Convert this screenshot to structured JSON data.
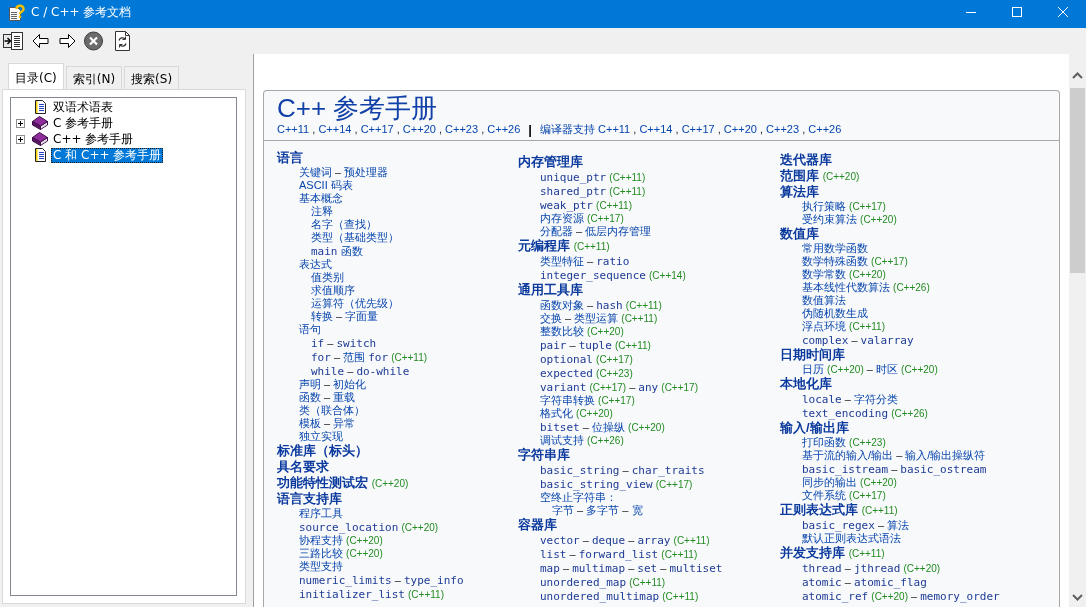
{
  "window": {
    "title": "C / C++ 参考文档"
  },
  "tabs": [
    {
      "label": "目录(C)",
      "selected": true
    },
    {
      "label": "索引(N)",
      "selected": false
    },
    {
      "label": "搜索(S)",
      "selected": false
    }
  ],
  "tree": {
    "items": [
      {
        "kind": "page",
        "label": "双语术语表",
        "selected": false
      },
      {
        "kind": "book",
        "label": "C 参考手册",
        "expanded": false,
        "selected": false
      },
      {
        "kind": "book",
        "label": "C++ 参考手册",
        "expanded": false,
        "selected": false
      },
      {
        "kind": "page",
        "label": "C 和 C++ 参考手册",
        "selected": true
      }
    ]
  },
  "page": {
    "title": "C++ 参考手册",
    "standards": [
      {
        "kind": "link",
        "text": "C++11"
      },
      {
        "kind": "sep",
        "text": ","
      },
      {
        "kind": "link",
        "text": "C++14"
      },
      {
        "kind": "sep",
        "text": ","
      },
      {
        "kind": "link",
        "text": "C++17"
      },
      {
        "kind": "sep",
        "text": ","
      },
      {
        "kind": "link",
        "text": "C++20"
      },
      {
        "kind": "sep",
        "text": ","
      },
      {
        "kind": "link",
        "text": "C++23"
      },
      {
        "kind": "sep",
        "text": ","
      },
      {
        "kind": "link",
        "text": "C++26"
      }
    ],
    "divider": "|",
    "compiler_support": [
      {
        "kind": "link",
        "text": "编译器支持"
      },
      {
        "kind": "link",
        "text": "C++11"
      },
      {
        "kind": "sep",
        "text": ","
      },
      {
        "kind": "link",
        "text": "C++14"
      },
      {
        "kind": "sep",
        "text": ","
      },
      {
        "kind": "link",
        "text": "C++17"
      },
      {
        "kind": "sep",
        "text": ","
      },
      {
        "kind": "link",
        "text": "C++20"
      },
      {
        "kind": "sep",
        "text": ","
      },
      {
        "kind": "link",
        "text": "C++23"
      },
      {
        "kind": "sep",
        "text": ","
      },
      {
        "kind": "link",
        "text": "C++26"
      }
    ],
    "columns": [
      {
        "sections": [
          {
            "heading": [
              {
                "kind": "text",
                "text": "语言"
              }
            ],
            "items": [
              {
                "parts": [
                  {
                    "kind": "text",
                    "text": "关键词"
                  },
                  {
                    "kind": "sep",
                    "text": "–"
                  },
                  {
                    "kind": "text",
                    "text": "预处理器"
                  }
                ]
              },
              {
                "parts": [
                  {
                    "kind": "text",
                    "text": "ASCII 码表"
                  }
                ]
              },
              {
                "parts": [
                  {
                    "kind": "text",
                    "text": "基本概念"
                  }
                ],
                "children": [
                  {
                    "parts": [
                      {
                        "kind": "text",
                        "text": "注释"
                      }
                    ]
                  },
                  {
                    "parts": [
                      {
                        "kind": "text",
                        "text": "名字（查找）"
                      }
                    ]
                  },
                  {
                    "parts": [
                      {
                        "kind": "text",
                        "text": "类型（基础类型）"
                      }
                    ]
                  },
                  {
                    "parts": [
                      {
                        "kind": "code",
                        "text": "main"
                      },
                      {
                        "kind": "text",
                        "text": "函数"
                      }
                    ]
                  }
                ]
              },
              {
                "parts": [
                  {
                    "kind": "text",
                    "text": "表达式"
                  }
                ],
                "children": [
                  {
                    "parts": [
                      {
                        "kind": "text",
                        "text": "值类别"
                      }
                    ]
                  },
                  {
                    "parts": [
                      {
                        "kind": "text",
                        "text": "求值顺序"
                      }
                    ]
                  },
                  {
                    "parts": [
                      {
                        "kind": "text",
                        "text": "运算符（优先级）"
                      }
                    ]
                  },
                  {
                    "parts": [
                      {
                        "kind": "text",
                        "text": "转换"
                      },
                      {
                        "kind": "sep",
                        "text": "–"
                      },
                      {
                        "kind": "text",
                        "text": "字面量"
                      }
                    ]
                  }
                ]
              },
              {
                "parts": [
                  {
                    "kind": "text",
                    "text": "语句"
                  }
                ],
                "children": [
                  {
                    "parts": [
                      {
                        "kind": "code",
                        "text": "if"
                      },
                      {
                        "kind": "sep",
                        "text": "–"
                      },
                      {
                        "kind": "code",
                        "text": "switch"
                      }
                    ]
                  },
                  {
                    "parts": [
                      {
                        "kind": "code",
                        "text": "for"
                      },
                      {
                        "kind": "sep",
                        "text": "–"
                      },
                      {
                        "kind": "text",
                        "text": "范围"
                      },
                      {
                        "kind": "code",
                        "text": "for"
                      },
                      {
                        "kind": "version",
                        "text": "(C++11)"
                      }
                    ]
                  },
                  {
                    "parts": [
                      {
                        "kind": "code",
                        "text": "while"
                      },
                      {
                        "kind": "sep",
                        "text": "–"
                      },
                      {
                        "kind": "code",
                        "text": "do-while"
                      }
                    ]
                  }
                ]
              },
              {
                "parts": [
                  {
                    "kind": "text",
                    "text": "声明"
                  },
                  {
                    "kind": "sep",
                    "text": "–"
                  },
                  {
                    "kind": "text",
                    "text": "初始化"
                  }
                ]
              },
              {
                "parts": [
                  {
                    "kind": "text",
                    "text": "函数"
                  },
                  {
                    "kind": "sep",
                    "text": "–"
                  },
                  {
                    "kind": "text",
                    "text": "重载"
                  }
                ]
              },
              {
                "parts": [
                  {
                    "kind": "text",
                    "text": "类（联合体）"
                  }
                ]
              },
              {
                "parts": [
                  {
                    "kind": "text",
                    "text": "模板"
                  },
                  {
                    "kind": "sep",
                    "text": "–"
                  },
                  {
                    "kind": "text",
                    "text": "异常"
                  }
                ]
              },
              {
                "parts": [
                  {
                    "kind": "text",
                    "text": "独立实现"
                  }
                ]
              }
            ]
          },
          {
            "heading": [
              {
                "kind": "text",
                "text": "标准库（标头）"
              }
            ]
          },
          {
            "heading": [
              {
                "kind": "text",
                "text": "具名要求"
              }
            ]
          },
          {
            "heading": [
              {
                "kind": "text",
                "text": "功能特性测试宏"
              },
              {
                "kind": "version",
                "text": "(C++20)"
              }
            ]
          },
          {
            "heading": [
              {
                "kind": "text",
                "text": "语言支持库"
              }
            ],
            "items": [
              {
                "parts": [
                  {
                    "kind": "text",
                    "text": "程序工具"
                  }
                ]
              },
              {
                "parts": [
                  {
                    "kind": "code",
                    "text": "source_location"
                  },
                  {
                    "kind": "version",
                    "text": "(C++20)"
                  }
                ]
              },
              {
                "parts": [
                  {
                    "kind": "text",
                    "text": "协程支持"
                  },
                  {
                    "kind": "version",
                    "text": "(C++20)"
                  }
                ]
              },
              {
                "parts": [
                  {
                    "kind": "text",
                    "text": "三路比较"
                  },
                  {
                    "kind": "version",
                    "text": "(C++20)"
                  }
                ]
              },
              {
                "parts": [
                  {
                    "kind": "text",
                    "text": "类型支持"
                  }
                ]
              },
              {
                "parts": [
                  {
                    "kind": "code",
                    "text": "numeric_limits"
                  },
                  {
                    "kind": "sep",
                    "text": "–"
                  },
                  {
                    "kind": "code",
                    "text": "type_info"
                  }
                ]
              },
              {
                "parts": [
                  {
                    "kind": "code",
                    "text": "initializer_list"
                  },
                  {
                    "kind": "version",
                    "text": "(C++11)"
                  }
                ]
              }
            ]
          }
        ]
      },
      {
        "sections": [
          {
            "heading": [
              {
                "kind": "text",
                "text": "内存管理库"
              }
            ],
            "items": [
              {
                "parts": [
                  {
                    "kind": "code",
                    "text": "unique_ptr"
                  },
                  {
                    "kind": "version",
                    "text": "(C++11)"
                  }
                ]
              },
              {
                "parts": [
                  {
                    "kind": "code",
                    "text": "shared_ptr"
                  },
                  {
                    "kind": "version",
                    "text": "(C++11)"
                  }
                ]
              },
              {
                "parts": [
                  {
                    "kind": "code",
                    "text": "weak_ptr"
                  },
                  {
                    "kind": "version",
                    "text": "(C++11)"
                  }
                ]
              },
              {
                "parts": [
                  {
                    "kind": "text",
                    "text": "内存资源"
                  },
                  {
                    "kind": "version",
                    "text": "(C++17)"
                  }
                ]
              },
              {
                "parts": [
                  {
                    "kind": "text",
                    "text": "分配器"
                  },
                  {
                    "kind": "sep",
                    "text": "–"
                  },
                  {
                    "kind": "text",
                    "text": "低层内存管理"
                  }
                ]
              }
            ]
          },
          {
            "heading": [
              {
                "kind": "text",
                "text": "元编程库"
              },
              {
                "kind": "version",
                "text": "(C++11)"
              }
            ],
            "items": [
              {
                "parts": [
                  {
                    "kind": "text",
                    "text": "类型特征"
                  },
                  {
                    "kind": "sep",
                    "text": "–"
                  },
                  {
                    "kind": "code",
                    "text": "ratio"
                  }
                ]
              },
              {
                "parts": [
                  {
                    "kind": "code",
                    "text": "integer_sequence"
                  },
                  {
                    "kind": "version",
                    "text": "(C++14)"
                  }
                ]
              }
            ]
          },
          {
            "heading": [
              {
                "kind": "text",
                "text": "通用工具库"
              }
            ],
            "items": [
              {
                "parts": [
                  {
                    "kind": "text",
                    "text": "函数对象"
                  },
                  {
                    "kind": "sep",
                    "text": "–"
                  },
                  {
                    "kind": "code",
                    "text": "hash"
                  },
                  {
                    "kind": "version",
                    "text": "(C++11)"
                  }
                ]
              },
              {
                "parts": [
                  {
                    "kind": "text",
                    "text": "交换"
                  },
                  {
                    "kind": "sep",
                    "text": "–"
                  },
                  {
                    "kind": "text",
                    "text": "类型运算"
                  },
                  {
                    "kind": "version",
                    "text": "(C++11)"
                  }
                ]
              },
              {
                "parts": [
                  {
                    "kind": "text",
                    "text": "整数比较"
                  },
                  {
                    "kind": "version",
                    "text": "(C++20)"
                  }
                ]
              },
              {
                "parts": [
                  {
                    "kind": "code",
                    "text": "pair"
                  },
                  {
                    "kind": "sep",
                    "text": "–"
                  },
                  {
                    "kind": "code",
                    "text": "tuple"
                  },
                  {
                    "kind": "version",
                    "text": "(C++11)"
                  }
                ]
              },
              {
                "parts": [
                  {
                    "kind": "code",
                    "text": "optional"
                  },
                  {
                    "kind": "version",
                    "text": "(C++17)"
                  }
                ]
              },
              {
                "parts": [
                  {
                    "kind": "code",
                    "text": "expected"
                  },
                  {
                    "kind": "version",
                    "text": "(C++23)"
                  }
                ]
              },
              {
                "parts": [
                  {
                    "kind": "code",
                    "text": "variant"
                  },
                  {
                    "kind": "version",
                    "text": "(C++17)"
                  },
                  {
                    "kind": "sep",
                    "text": "–"
                  },
                  {
                    "kind": "code",
                    "text": "any"
                  },
                  {
                    "kind": "version",
                    "text": "(C++17)"
                  }
                ]
              },
              {
                "parts": [
                  {
                    "kind": "text",
                    "text": "字符串转换"
                  },
                  {
                    "kind": "version",
                    "text": "(C++17)"
                  }
                ]
              },
              {
                "parts": [
                  {
                    "kind": "text",
                    "text": "格式化"
                  },
                  {
                    "kind": "version",
                    "text": "(C++20)"
                  }
                ]
              },
              {
                "parts": [
                  {
                    "kind": "code",
                    "text": "bitset"
                  },
                  {
                    "kind": "sep",
                    "text": "–"
                  },
                  {
                    "kind": "text",
                    "text": "位操纵"
                  },
                  {
                    "kind": "version",
                    "text": "(C++20)"
                  }
                ]
              },
              {
                "parts": [
                  {
                    "kind": "text",
                    "text": "调试支持"
                  },
                  {
                    "kind": "version",
                    "text": "(C++26)"
                  }
                ]
              }
            ]
          },
          {
            "heading": [
              {
                "kind": "text",
                "text": "字符串库"
              }
            ],
            "items": [
              {
                "parts": [
                  {
                    "kind": "code",
                    "text": "basic_string"
                  },
                  {
                    "kind": "sep",
                    "text": "–"
                  },
                  {
                    "kind": "code",
                    "text": "char_traits"
                  }
                ]
              },
              {
                "parts": [
                  {
                    "kind": "code",
                    "text": "basic_string_view"
                  },
                  {
                    "kind": "version",
                    "text": "(C++17)"
                  }
                ]
              },
              {
                "parts": [
                  {
                    "kind": "text",
                    "text": "空终止字符串："
                  }
                ],
                "children": [
                  {
                    "parts": [
                      {
                        "kind": "text",
                        "text": "字节"
                      },
                      {
                        "kind": "sep",
                        "text": "–"
                      },
                      {
                        "kind": "text",
                        "text": "多字节"
                      },
                      {
                        "kind": "sep",
                        "text": "–"
                      },
                      {
                        "kind": "text",
                        "text": "宽"
                      }
                    ]
                  }
                ]
              }
            ]
          },
          {
            "heading": [
              {
                "kind": "text",
                "text": "容器库"
              }
            ],
            "items": [
              {
                "parts": [
                  {
                    "kind": "code",
                    "text": "vector"
                  },
                  {
                    "kind": "sep",
                    "text": "–"
                  },
                  {
                    "kind": "code",
                    "text": "deque"
                  },
                  {
                    "kind": "sep",
                    "text": "–"
                  },
                  {
                    "kind": "code",
                    "text": "array"
                  },
                  {
                    "kind": "version",
                    "text": "(C++11)"
                  }
                ]
              },
              {
                "parts": [
                  {
                    "kind": "code",
                    "text": "list"
                  },
                  {
                    "kind": "sep",
                    "text": "–"
                  },
                  {
                    "kind": "code",
                    "text": "forward_list"
                  },
                  {
                    "kind": "version",
                    "text": "(C++11)"
                  }
                ]
              },
              {
                "parts": [
                  {
                    "kind": "code",
                    "text": "map"
                  },
                  {
                    "kind": "sep",
                    "text": "–"
                  },
                  {
                    "kind": "code",
                    "text": "multimap"
                  },
                  {
                    "kind": "sep",
                    "text": "–"
                  },
                  {
                    "kind": "code",
                    "text": "set"
                  },
                  {
                    "kind": "sep",
                    "text": "–"
                  },
                  {
                    "kind": "code",
                    "text": "multiset"
                  }
                ]
              },
              {
                "parts": [
                  {
                    "kind": "code",
                    "text": "unordered_map"
                  },
                  {
                    "kind": "version",
                    "text": "(C++11)"
                  }
                ]
              },
              {
                "parts": [
                  {
                    "kind": "code",
                    "text": "unordered_multimap"
                  },
                  {
                    "kind": "version",
                    "text": "(C++11)"
                  }
                ]
              }
            ]
          }
        ]
      },
      {
        "sections": [
          {
            "heading": [
              {
                "kind": "text",
                "text": "迭代器库"
              }
            ]
          },
          {
            "heading": [
              {
                "kind": "text",
                "text": "范围库"
              },
              {
                "kind": "version",
                "text": "(C++20)"
              }
            ]
          },
          {
            "heading": [
              {
                "kind": "text",
                "text": "算法库"
              }
            ],
            "items": [
              {
                "parts": [
                  {
                    "kind": "text",
                    "text": "执行策略"
                  },
                  {
                    "kind": "version",
                    "text": "(C++17)"
                  }
                ]
              },
              {
                "parts": [
                  {
                    "kind": "text",
                    "text": "受约束算法"
                  },
                  {
                    "kind": "version",
                    "text": "(C++20)"
                  }
                ]
              }
            ]
          },
          {
            "heading": [
              {
                "kind": "text",
                "text": "数值库"
              }
            ],
            "items": [
              {
                "parts": [
                  {
                    "kind": "text",
                    "text": "常用数学函数"
                  }
                ]
              },
              {
                "parts": [
                  {
                    "kind": "text",
                    "text": "数学特殊函数"
                  },
                  {
                    "kind": "version",
                    "text": "(C++17)"
                  }
                ]
              },
              {
                "parts": [
                  {
                    "kind": "text",
                    "text": "数学常数"
                  },
                  {
                    "kind": "version",
                    "text": "(C++20)"
                  }
                ]
              },
              {
                "parts": [
                  {
                    "kind": "text",
                    "text": "基本线性代数算法"
                  },
                  {
                    "kind": "version",
                    "text": "(C++26)"
                  }
                ]
              },
              {
                "parts": [
                  {
                    "kind": "text",
                    "text": "数值算法"
                  }
                ]
              },
              {
                "parts": [
                  {
                    "kind": "text",
                    "text": "伪随机数生成"
                  }
                ]
              },
              {
                "parts": [
                  {
                    "kind": "text",
                    "text": "浮点环境"
                  },
                  {
                    "kind": "version",
                    "text": "(C++11)"
                  }
                ]
              },
              {
                "parts": [
                  {
                    "kind": "code",
                    "text": "complex"
                  },
                  {
                    "kind": "sep",
                    "text": "–"
                  },
                  {
                    "kind": "code",
                    "text": "valarray"
                  }
                ]
              }
            ]
          },
          {
            "heading": [
              {
                "kind": "text",
                "text": "日期时间库"
              }
            ],
            "items": [
              {
                "parts": [
                  {
                    "kind": "text",
                    "text": "日历"
                  },
                  {
                    "kind": "version",
                    "text": "(C++20)"
                  },
                  {
                    "kind": "sep",
                    "text": "–"
                  },
                  {
                    "kind": "text",
                    "text": "时区"
                  },
                  {
                    "kind": "version",
                    "text": "(C++20)"
                  }
                ]
              }
            ]
          },
          {
            "heading": [
              {
                "kind": "text",
                "text": "本地化库"
              }
            ],
            "items": [
              {
                "parts": [
                  {
                    "kind": "code",
                    "text": "locale"
                  },
                  {
                    "kind": "sep",
                    "text": "–"
                  },
                  {
                    "kind": "text",
                    "text": "字符分类"
                  }
                ]
              },
              {
                "parts": [
                  {
                    "kind": "code",
                    "text": "text_encoding"
                  },
                  {
                    "kind": "version",
                    "text": "(C++26)"
                  }
                ]
              }
            ]
          },
          {
            "heading": [
              {
                "kind": "text",
                "text": "输入/输出库"
              }
            ],
            "items": [
              {
                "parts": [
                  {
                    "kind": "text",
                    "text": "打印函数"
                  },
                  {
                    "kind": "version",
                    "text": "(C++23)"
                  }
                ]
              },
              {
                "parts": [
                  {
                    "kind": "text",
                    "text": "基于流的输入/输出"
                  },
                  {
                    "kind": "sep",
                    "text": "–"
                  },
                  {
                    "kind": "text",
                    "text": "输入/输出操纵符"
                  }
                ]
              },
              {
                "parts": [
                  {
                    "kind": "code",
                    "text": "basic_istream"
                  },
                  {
                    "kind": "sep",
                    "text": "–"
                  },
                  {
                    "kind": "code",
                    "text": "basic_ostream"
                  }
                ]
              },
              {
                "parts": [
                  {
                    "kind": "text",
                    "text": "同步的输出"
                  },
                  {
                    "kind": "version",
                    "text": "(C++20)"
                  }
                ]
              },
              {
                "parts": [
                  {
                    "kind": "text",
                    "text": "文件系统"
                  },
                  {
                    "kind": "version",
                    "text": "(C++17)"
                  }
                ]
              }
            ]
          },
          {
            "heading": [
              {
                "kind": "text",
                "text": "正则表达式库"
              },
              {
                "kind": "version",
                "text": "(C++11)"
              }
            ],
            "items": [
              {
                "parts": [
                  {
                    "kind": "code",
                    "text": "basic_regex"
                  },
                  {
                    "kind": "sep",
                    "text": "–"
                  },
                  {
                    "kind": "text",
                    "text": "算法"
                  }
                ]
              },
              {
                "parts": [
                  {
                    "kind": "text",
                    "text": "默认正则表达式语法"
                  }
                ]
              }
            ]
          },
          {
            "heading": [
              {
                "kind": "text",
                "text": "并发支持库"
              },
              {
                "kind": "version",
                "text": "(C++11)"
              }
            ],
            "items": [
              {
                "parts": [
                  {
                    "kind": "code",
                    "text": "thread"
                  },
                  {
                    "kind": "sep",
                    "text": "–"
                  },
                  {
                    "kind": "code",
                    "text": "jthread"
                  },
                  {
                    "kind": "version",
                    "text": "(C++20)"
                  }
                ]
              },
              {
                "parts": [
                  {
                    "kind": "code",
                    "text": "atomic"
                  },
                  {
                    "kind": "sep",
                    "text": "–"
                  },
                  {
                    "kind": "code",
                    "text": "atomic_flag"
                  }
                ]
              },
              {
                "parts": [
                  {
                    "kind": "code",
                    "text": "atomic_ref"
                  },
                  {
                    "kind": "version",
                    "text": "(C++20)"
                  },
                  {
                    "kind": "sep",
                    "text": "–"
                  },
                  {
                    "kind": "code",
                    "text": "memory_order"
                  }
                ]
              }
            ]
          }
        ]
      }
    ]
  }
}
